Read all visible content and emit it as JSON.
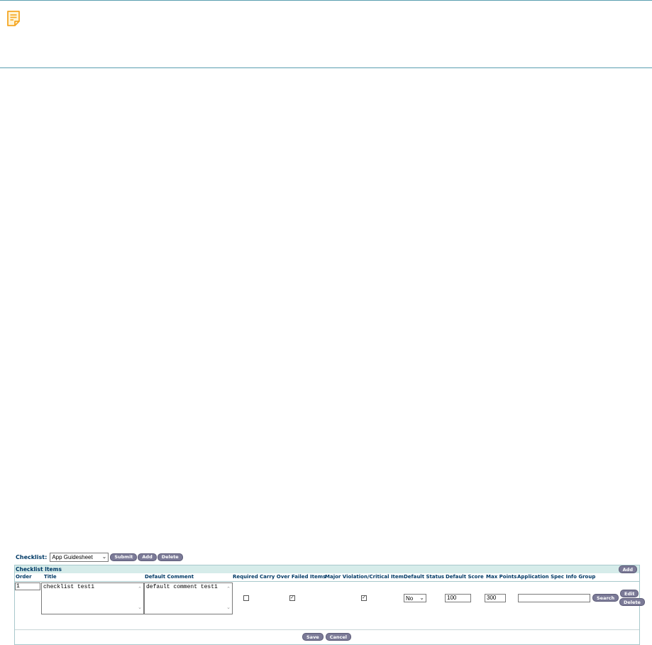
{
  "banner": {
    "icon": "note-icon",
    "icon_color": "#f5a623"
  },
  "checklist": {
    "label": "Checklist:",
    "selected": "App Guidesheet",
    "submit_label": "Submit",
    "add_label": "Add",
    "delete_label": "Delete"
  },
  "items": {
    "title": "Checklist Items",
    "add_label": "Add",
    "columns": {
      "order": "Order",
      "title": "Title",
      "default_comment": "Default Comment",
      "required": "Required",
      "carry_over": "Carry Over Failed Items",
      "major_violation": "Major Violation/Critical Item",
      "default_status": "Default Status",
      "default_score": "Default Score",
      "max_points": "Max Points",
      "app_spec": "Application Spec Info Group"
    },
    "row": {
      "order": "1",
      "title": "checklist test1",
      "default_comment": "default comment test1",
      "required": false,
      "carry_over": true,
      "major_violation": true,
      "default_status": "No",
      "default_score": "100",
      "max_points": "300",
      "app_spec": "",
      "search_label": "Search",
      "edit_label": "Edit",
      "delete_label": "Delete"
    }
  },
  "footer": {
    "save_label": "Save",
    "cancel_label": "Cancel"
  },
  "colors": {
    "button": "#7b7a97",
    "header_text": "#003a66",
    "header_bg": "#d6ecea",
    "border": "#5a9fb0"
  }
}
